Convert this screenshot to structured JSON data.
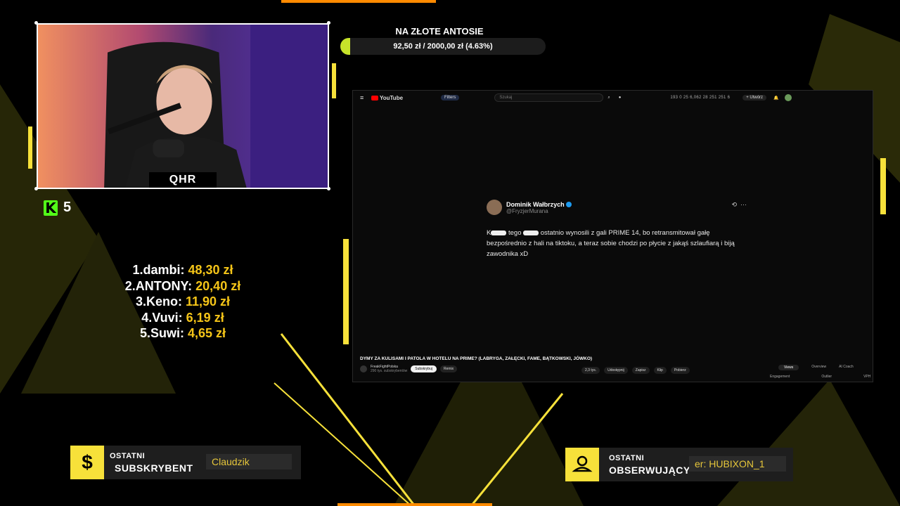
{
  "webcam": {
    "name_tag": "QHR"
  },
  "kick": {
    "viewer_count": "5",
    "icon": "kick-logo"
  },
  "goal": {
    "title": "NA ZŁOTE ANTOSIE",
    "progress_text": "92,50 zł  /  2000,00 zł  (4.63%)",
    "fraction": 0.0463
  },
  "donors": [
    {
      "rank": "1.",
      "name": "dambi:",
      "amount": "48,30 zł"
    },
    {
      "rank": "2.",
      "name": "ANTONY:",
      "amount": "20,40 zł"
    },
    {
      "rank": "3.",
      "name": "Keno:",
      "amount": "11,90 zł"
    },
    {
      "rank": "4.",
      "name": "Vuvi:",
      "amount": "6,19 zł"
    },
    {
      "rank": "5.",
      "name": "Suwi:",
      "amount": "4,65 zł"
    }
  ],
  "youtube": {
    "logo": "YouTube",
    "filters": "Filters",
    "search_placeholder": "Szukaj",
    "topbar_stats": "193  0  25  6,062  28  251  251  6",
    "create": "+ Utwórz",
    "tweet": {
      "author": "Dominik Wałbrzych",
      "handle": "@FryzjerMurana",
      "body_pre": "K",
      "body_mid": " tego ",
      "body_post": " ostatnio wynosili z gali PRIME 14, bo retransmitował gałę bezpośrednio z hali na tiktoku, a teraz sobie chodzi po płycie z jakąś szlaufiarą i biją zawodnika xD"
    },
    "video_title": "DYMY ZA KULISAMI I PATOLA W HOTELU NA PRIME? (LABRYGA, ZAŁĘCKI, FAME, BĄTKOWSKI, JÓWKO)",
    "channel": "FreakFightPolska",
    "subscribers": "290 tys. subskrybentów",
    "subscribe": "Subskrybuj",
    "remix": "Remix",
    "likes": "2,3 tys.",
    "share": "Udostępnij",
    "save": "Zapisz",
    "clip": "Klip",
    "download": "Pobierz",
    "side_tabs": [
      "Views",
      "Overview",
      "AI Coach"
    ],
    "side_row": [
      "Engagement",
      "Outlier",
      "VPH"
    ]
  },
  "alerts": {
    "subscriber": {
      "label1": "OSTATNI",
      "label2": "SUBSKRYBENT",
      "value": "Claudzik",
      "icon": "dollar-icon"
    },
    "follower": {
      "label1": "OSTATNI",
      "label2": "OBSERWUJĄCY",
      "value": "er: HUBIXON_1",
      "icon": "user-icon"
    }
  },
  "colors": {
    "accent": "#f7e13a",
    "goal_fill": "#c7e32a",
    "kick": "#53fc18"
  }
}
